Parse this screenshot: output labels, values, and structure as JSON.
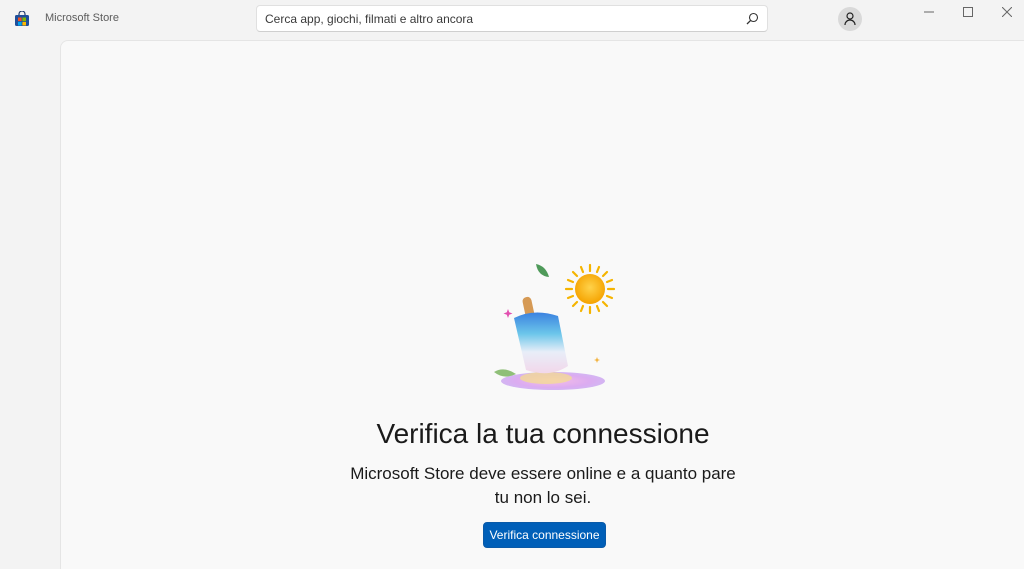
{
  "window": {
    "app_title": "Microsoft Store",
    "app_icon": "store-icon",
    "controls": [
      "minimize-icon",
      "maximize-icon",
      "close-icon"
    ]
  },
  "search": {
    "placeholder": "Cerca app, giochi, filmati e altro ancora",
    "icon": "search-icon"
  },
  "account": {
    "icon": "user-icon"
  },
  "error": {
    "title": "Verifica la tua connessione",
    "message": "Microsoft Store deve essere online e a quanto pare tu non lo sei.",
    "button_label": "Verifica connessione",
    "illustration": "melting-popsicle-illustration"
  },
  "colors": {
    "accent": "#005fb8",
    "background": "#f3f3f3",
    "content_background": "#f9f9f9"
  }
}
